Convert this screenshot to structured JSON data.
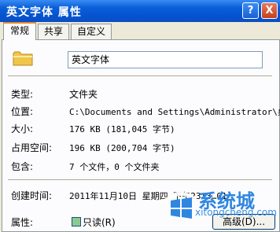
{
  "window": {
    "title": "英文字体 属性",
    "help_glyph": "?",
    "close_glyph": "X"
  },
  "tabs": [
    {
      "label": "常规",
      "active": true
    },
    {
      "label": "共享",
      "active": false
    },
    {
      "label": "自定义",
      "active": false
    }
  ],
  "general": {
    "name": "英文字体",
    "type_label": "类型:",
    "type_value": "文件夹",
    "location_label": "位置:",
    "location_value": "C:\\Documents and Settings\\Administrator\\桌",
    "size_label": "大小:",
    "size_value": "176 KB (181,045 字节)",
    "disk_label": "占用空间:",
    "disk_value": "196 KB (200,704 字节)",
    "contains_label": "包含:",
    "contains_value": "7 个文件，0 个文件夹",
    "created_label": "创建时间:",
    "created_value": "2011年11月10日 星期四 下午23:3…01",
    "attributes_label": "属性:",
    "readonly_label": "只读(R)",
    "advanced_label": "高级(D)..."
  },
  "watermark": {
    "brand": "系统城",
    "url": "xitongcheng.com"
  },
  "colors": {
    "titlebar": "#0553d0",
    "accent_tab": "#e68b2c",
    "dialog_bg": "#ece9d8"
  }
}
